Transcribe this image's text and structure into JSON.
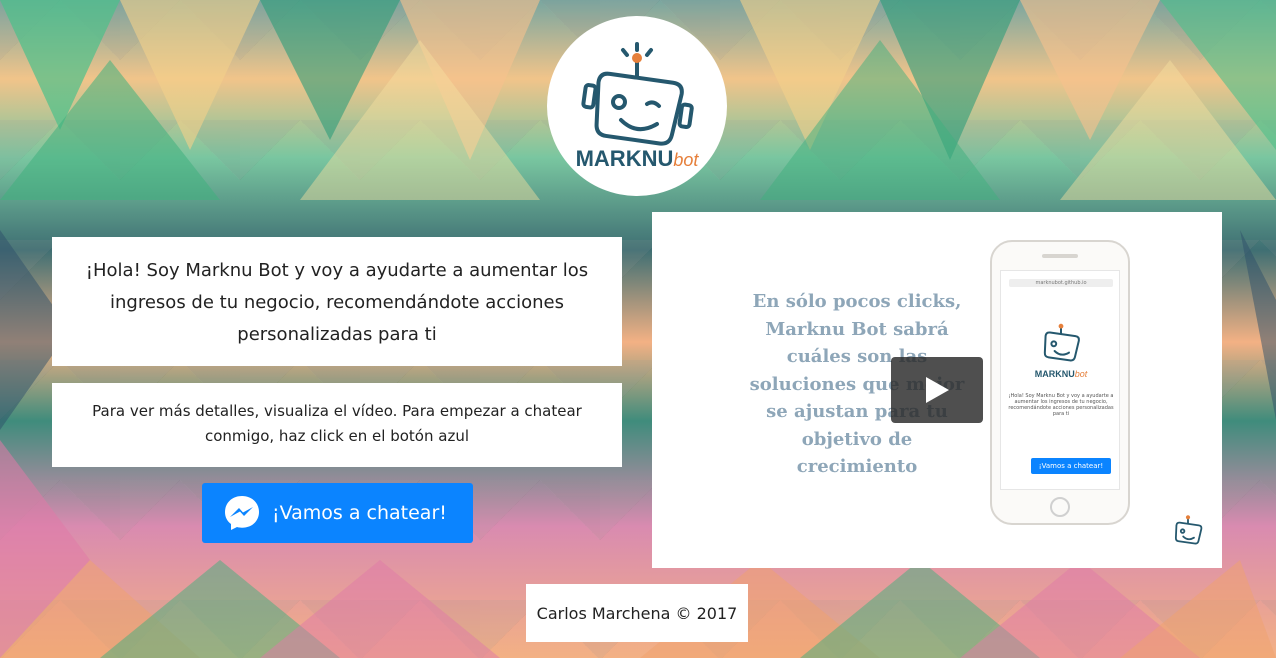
{
  "logo": {
    "brand": "MARKNU",
    "brand_suffix": "bot"
  },
  "intro": {
    "headline": "¡Hola! Soy Marknu Bot y voy a ayudarte a aumentar los ingresos de tu negocio, recomendándote acciones personalizadas para ti",
    "details": "Para ver más detalles, visualiza el vídeo. Para empezar a chatear conmigo, haz click en el botón azul"
  },
  "cta": {
    "label": "¡Vamos a chatear!",
    "icon": "messenger-icon",
    "color": "#0b84ff"
  },
  "video": {
    "caption": "En sólo pocos clicks, Marknu Bot sabrá cuáles son las soluciones que mejor se ajustan para tu objetivo de crecimiento",
    "phone_url": "marknubot.github.io",
    "phone_text": "¡Hola! Soy Marknu Bot y voy a ayudarte a aumentar los ingresos de tu negocio, recomendándote acciones personalizadas para ti",
    "phone_button": "¡Vamos a chatear!",
    "play_icon": "play-icon"
  },
  "footer": {
    "text": "Carlos Marchena © 2017"
  }
}
